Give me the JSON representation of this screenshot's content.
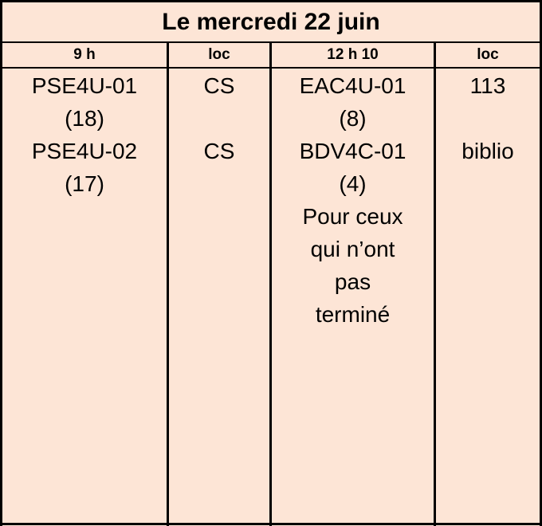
{
  "schedule": {
    "title": "Le mercredi 22 juin",
    "headers": [
      "9 h",
      "loc",
      "12 h 10",
      "loc"
    ],
    "col1": [
      "PSE4U-01",
      "(18)",
      "PSE4U-02",
      "(17)"
    ],
    "col2": [
      "CS",
      "",
      "CS"
    ],
    "col3": [
      "EAC4U-01",
      "(8)",
      "BDV4C-01",
      "(4)",
      "Pour ceux",
      "qui n’ont",
      "pas",
      "terminé"
    ],
    "col4": [
      "113",
      "",
      "biblio"
    ]
  }
}
